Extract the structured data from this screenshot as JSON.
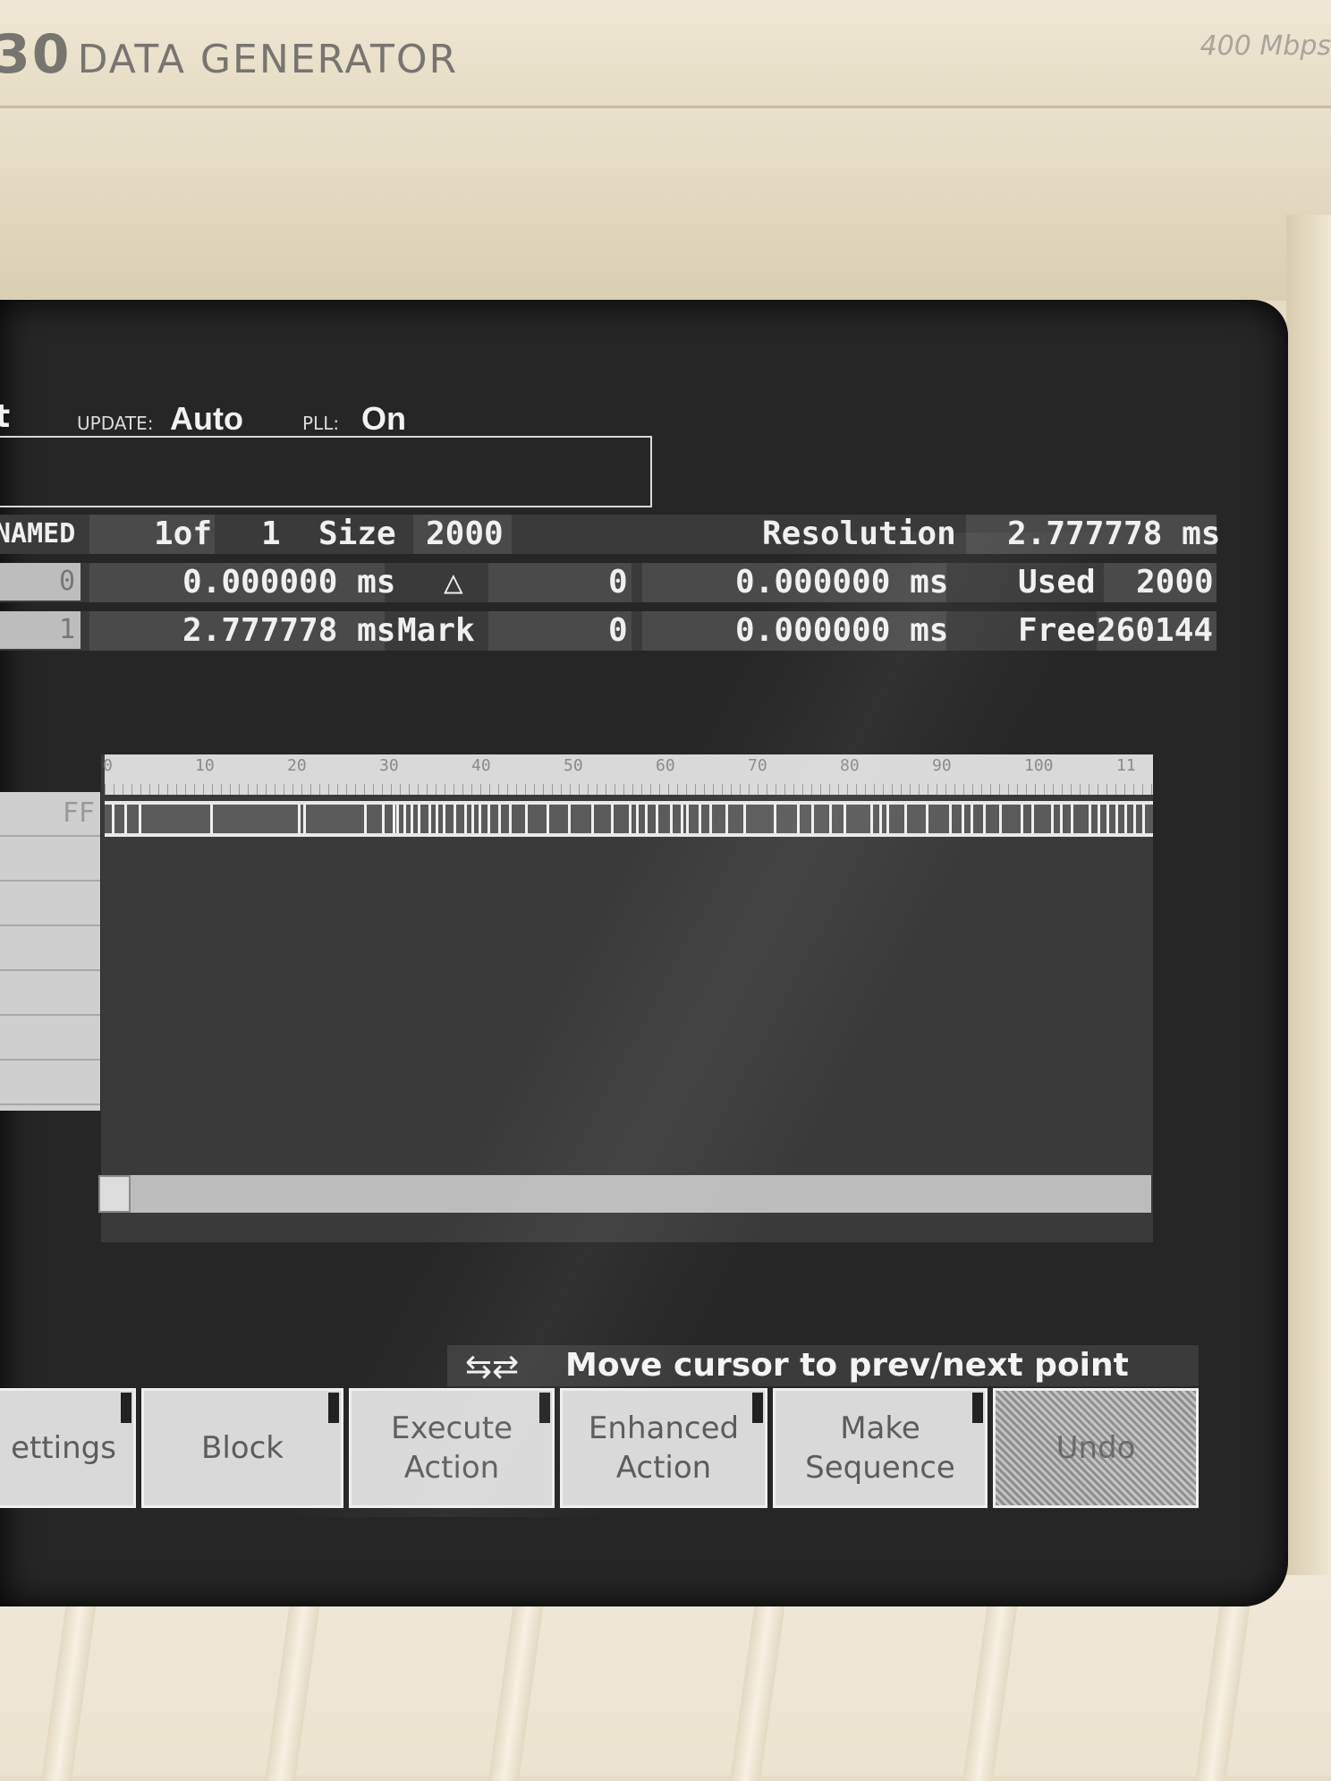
{
  "instrument": {
    "model_number": "30",
    "model_name": "DATA GENERATOR",
    "speed_label": "400 Mbps"
  },
  "status": {
    "mode_fragment": "t",
    "update_label": "UPDATE",
    "update_value": "Auto",
    "pll_label": "PLL",
    "pll_value": "On"
  },
  "block_info": {
    "block_name": "NAMED",
    "block_index": "1of",
    "block_total": "1",
    "size_label": "Size",
    "size_value": "2000",
    "resolution_label": "Resolution",
    "resolution_value": "2.777778 ms",
    "used_label": "Used",
    "used_value": "2000",
    "free_label": "Free",
    "free_value": "260144"
  },
  "cursors": {
    "cursor1_box": "0",
    "cursor1_time": "0.000000 ms",
    "delta_symbol": "△",
    "delta_value": "0",
    "delta_time": "0.000000 ms",
    "cursor2_box": "1",
    "cursor2_time": "2.777778 ms",
    "mark_label": "Mark",
    "mark_value": "0",
    "mark_time": "0.000000 ms"
  },
  "timing": {
    "ruler_labels": [
      "0",
      "10",
      "20",
      "30",
      "40",
      "50",
      "60",
      "70",
      "80",
      "90",
      "100",
      "11"
    ],
    "channel_label": "FF"
  },
  "help": {
    "arrows": "⇆⇄",
    "text": "Move cursor to prev/next point"
  },
  "softkeys": [
    {
      "label": "ettings"
    },
    {
      "label": "Block"
    },
    {
      "label": "Execute Action"
    },
    {
      "label": "Enhanced Action"
    },
    {
      "label": "Make Sequence"
    },
    {
      "label": "Undo"
    }
  ]
}
